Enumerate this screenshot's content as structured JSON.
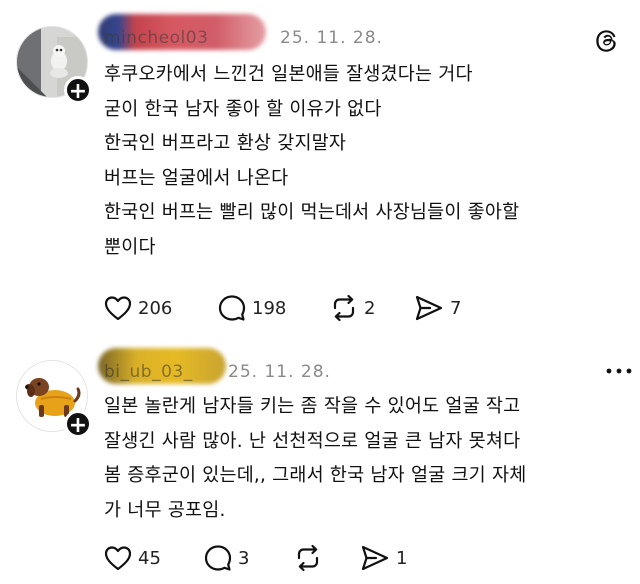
{
  "posts": [
    {
      "username": "mincheol03",
      "date": "25. 11. 28.",
      "lines": [
        "후쿠오카에서 느낀건 일본애들 잘생겼다는 거다",
        "굳이 한국 남자 좋아 할 이유가 없다",
        "한국인 버프라고 환상 갖지말자",
        "버프는 얼굴에서 나온다",
        "한국인 버프는 빨리 많이 먹는데서 사장님들이 좋아할",
        "뿐이다"
      ],
      "likes": "206",
      "comments": "198",
      "reposts": "2",
      "shares": "7"
    },
    {
      "username": "bi_ub_03_",
      "date": "25. 11. 28.",
      "lines": [
        "일본 놀란게 남자들 키는 좀 작을 수 있어도 얼굴 작고",
        "잘생긴 사람 많아. 난 선천적으로 얼굴 큰 남자 못쳐다",
        "봄 증후군이 있는데,, 그래서 한국 남자 얼굴 크기 자체",
        "가 너무 공포임."
      ],
      "likes": "45",
      "comments": "3",
      "reposts": "",
      "shares": "1"
    }
  ],
  "icons": {
    "like": "heart-icon",
    "comment": "comment-bubble-icon",
    "repost": "repost-icon",
    "share": "send-icon",
    "app": "threads-logo-icon",
    "more": "more-options-icon",
    "follow": "plus-follow-icon"
  }
}
